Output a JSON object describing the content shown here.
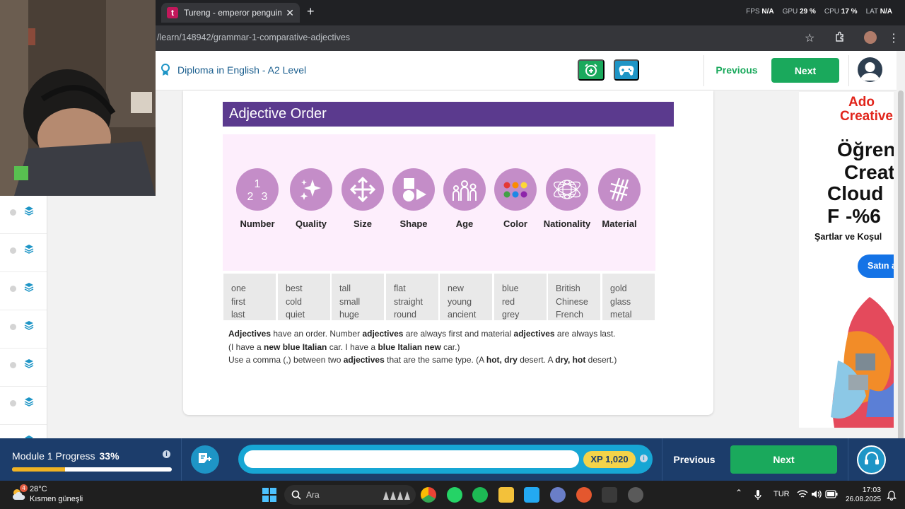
{
  "browser": {
    "tab_title": "Tureng - emperor penguin - Tü",
    "tab_favicon": "t",
    "url": "/learn/148942/grammar-1-comparative-adjectives",
    "stats": [
      {
        "label": "FPS",
        "value": "N/A"
      },
      {
        "label": "GPU",
        "value": "29 %"
      },
      {
        "label": "CPU",
        "value": "17 %"
      },
      {
        "label": "LAT",
        "value": "N/A"
      }
    ]
  },
  "header": {
    "course_title": "Diploma in English - A2 Level",
    "previous_label": "Previous",
    "next_label": "Next"
  },
  "lesson": {
    "title": "Adjective Order",
    "categories": [
      {
        "label": "Number",
        "icon": "number-icon",
        "examples": [
          "one",
          "first",
          "last"
        ]
      },
      {
        "label": "Quality",
        "icon": "sparkle-icon",
        "examples": [
          "best",
          "cold",
          "quiet"
        ]
      },
      {
        "label": "Size",
        "icon": "resize-arrows-icon",
        "examples": [
          "tall",
          "small",
          "huge"
        ]
      },
      {
        "label": "Shape",
        "icon": "shapes-icon",
        "examples": [
          "flat",
          "straight",
          "round"
        ]
      },
      {
        "label": "Age",
        "icon": "people-age-icon",
        "examples": [
          "new",
          "young",
          "ancient"
        ]
      },
      {
        "label": "Color",
        "icon": "color-dots-icon",
        "examples": [
          "blue",
          "red",
          "grey"
        ]
      },
      {
        "label": "Nationality",
        "icon": "globe-icon",
        "examples": [
          "British",
          "Chinese",
          "French"
        ]
      },
      {
        "label": "Material",
        "icon": "material-icon",
        "examples": [
          "gold",
          "glass",
          "metal"
        ]
      }
    ],
    "explanation": [
      [
        {
          "t": "Adjectives",
          "b": true
        },
        {
          "t": " have an order.  Number "
        },
        {
          "t": "adjectives",
          "b": true
        },
        {
          "t": " are always first and material "
        },
        {
          "t": "adjectives",
          "b": true
        },
        {
          "t": " are always last."
        }
      ],
      [
        {
          "t": "(I have a "
        },
        {
          "t": "new blue Italian",
          "b": true
        },
        {
          "t": " car. I have a "
        },
        {
          "t": "blue Italian new",
          "b": true
        },
        {
          "t": " car.)"
        }
      ],
      [
        {
          "t": "Use a comma (,) between two "
        },
        {
          "t": "adjectives",
          "b": true
        },
        {
          "t": " that are the same type. (A "
        },
        {
          "t": "hot, dry",
          "b": true
        },
        {
          "t": " desert.  A "
        },
        {
          "t": "dry, hot",
          "b": true
        },
        {
          "t": " desert.)"
        }
      ]
    ]
  },
  "ad": {
    "lines": [
      "Ado",
      "Creative",
      "Öğren",
      "Creat",
      "Cloud F",
      "-%6",
      "Şartlar ve Koşul"
    ],
    "button": "Satın a"
  },
  "bottom": {
    "module_label": "Module 1 Progress",
    "module_percent": "33%",
    "progress": 0.33,
    "info": "i",
    "xp_label": "XP 1,020",
    "previous_label": "Previous",
    "next_label": "Next"
  },
  "taskbar": {
    "weather_badge": "4",
    "temperature": "28°C",
    "weather_desc": "Kısmen güneşli",
    "search_label": "Ara",
    "language": "TUR",
    "time": "17:03",
    "date": "26.08.2025"
  },
  "colors": {
    "brand_green": "#1aa95c",
    "brand_blue": "#1e95c6",
    "title_purple": "#5b3a8e",
    "circle_purple": "#c48dc8",
    "bottom_bar": "#1c3d6b",
    "xp_yellow": "#f3d349"
  }
}
